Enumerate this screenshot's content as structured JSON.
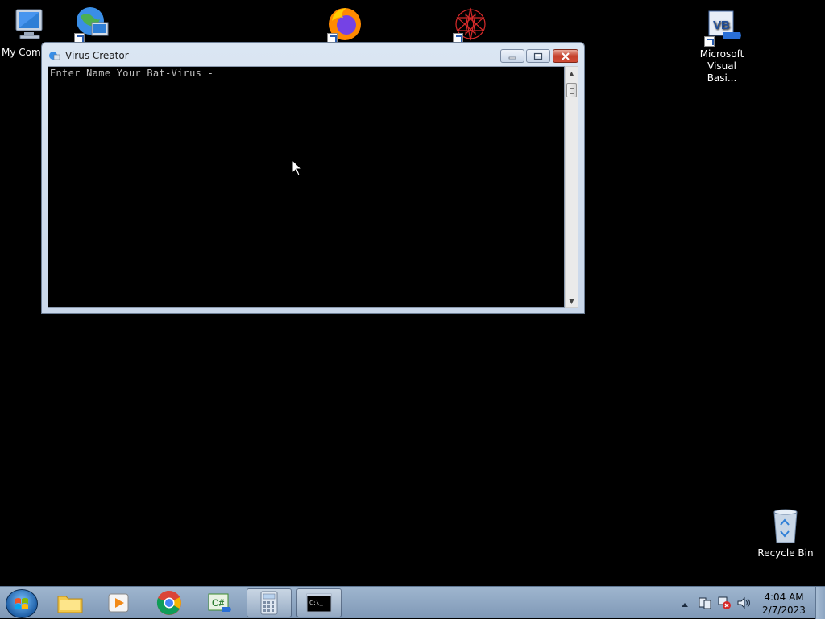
{
  "desktop": {
    "icons": [
      {
        "label": "My Comp",
        "name": "my-computer"
      },
      {
        "label": "",
        "name": "network"
      },
      {
        "label": "",
        "name": "firefox"
      },
      {
        "label": "",
        "name": "red-app"
      },
      {
        "label": "Microsoft Visual Basi...",
        "name": "visual-basic"
      },
      {
        "label": "Recycle Bin",
        "name": "recycle-bin"
      }
    ]
  },
  "window": {
    "title": "Virus Creator",
    "console_text": "Enter Name Your Bat-Virus -"
  },
  "taskbar": {
    "items": [
      {
        "name": "file-explorer"
      },
      {
        "name": "media-player"
      },
      {
        "name": "chrome"
      },
      {
        "name": "csharp"
      },
      {
        "name": "calculator"
      },
      {
        "name": "command-prompt"
      }
    ],
    "cmd_label": "C:\\_",
    "csharp_label": "C#",
    "clock_time": "4:04 AM",
    "clock_date": "2/7/2023"
  },
  "colors": {
    "desktop_bg": "#000000",
    "console_bg": "#000000",
    "console_fg": "#c0c0c0",
    "close_red": "#c4402b"
  }
}
